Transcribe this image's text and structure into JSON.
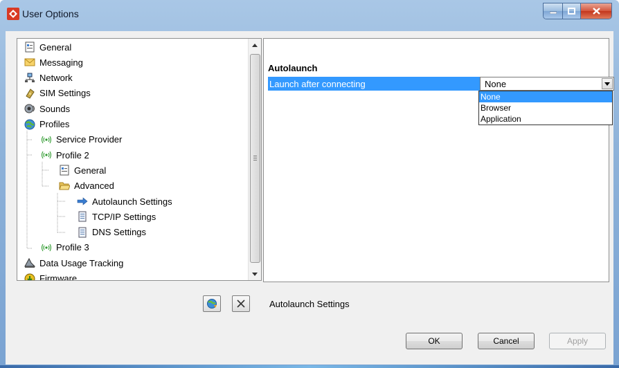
{
  "window": {
    "title": "User Options"
  },
  "tree": {
    "items": [
      {
        "label": "General",
        "icon": "general-icon",
        "indent": 0
      },
      {
        "label": "Messaging",
        "icon": "envelope-icon",
        "indent": 0
      },
      {
        "label": "Network",
        "icon": "network-icon",
        "indent": 0
      },
      {
        "label": "SIM Settings",
        "icon": "sim-icon",
        "indent": 0
      },
      {
        "label": "Sounds",
        "icon": "sound-icon",
        "indent": 0
      },
      {
        "label": "Profiles",
        "icon": "globe-icon",
        "indent": 0
      },
      {
        "label": "Service Provider",
        "icon": "antenna-icon",
        "indent": 1
      },
      {
        "label": "Profile 2",
        "icon": "antenna-icon",
        "indent": 1
      },
      {
        "label": "General",
        "icon": "general-icon",
        "indent": 2
      },
      {
        "label": "Advanced",
        "icon": "folder-open-icon",
        "indent": 2
      },
      {
        "label": "Autolaunch Settings",
        "icon": "arrow-right-icon",
        "indent": 3
      },
      {
        "label": "TCP/IP Settings",
        "icon": "document-icon",
        "indent": 3
      },
      {
        "label": "DNS Settings",
        "icon": "document-icon",
        "indent": 3
      },
      {
        "label": "Profile 3",
        "icon": "antenna-icon",
        "indent": 1
      },
      {
        "label": "Data Usage Tracking",
        "icon": "data-usage-icon",
        "indent": 0
      },
      {
        "label": "Firmware",
        "icon": "firmware-icon",
        "indent": 0
      }
    ]
  },
  "properties": {
    "section": "Autolaunch",
    "row_label": "Launch after connecting",
    "combo_value": "None",
    "options": [
      "None",
      "Browser",
      "Application"
    ],
    "selected_option": "None"
  },
  "description": "Autolaunch Settings",
  "buttons": {
    "ok": "OK",
    "cancel": "Cancel",
    "apply": "Apply"
  },
  "colors": {
    "selection": "#3399ff",
    "title_bar": "#8eb2d9"
  }
}
